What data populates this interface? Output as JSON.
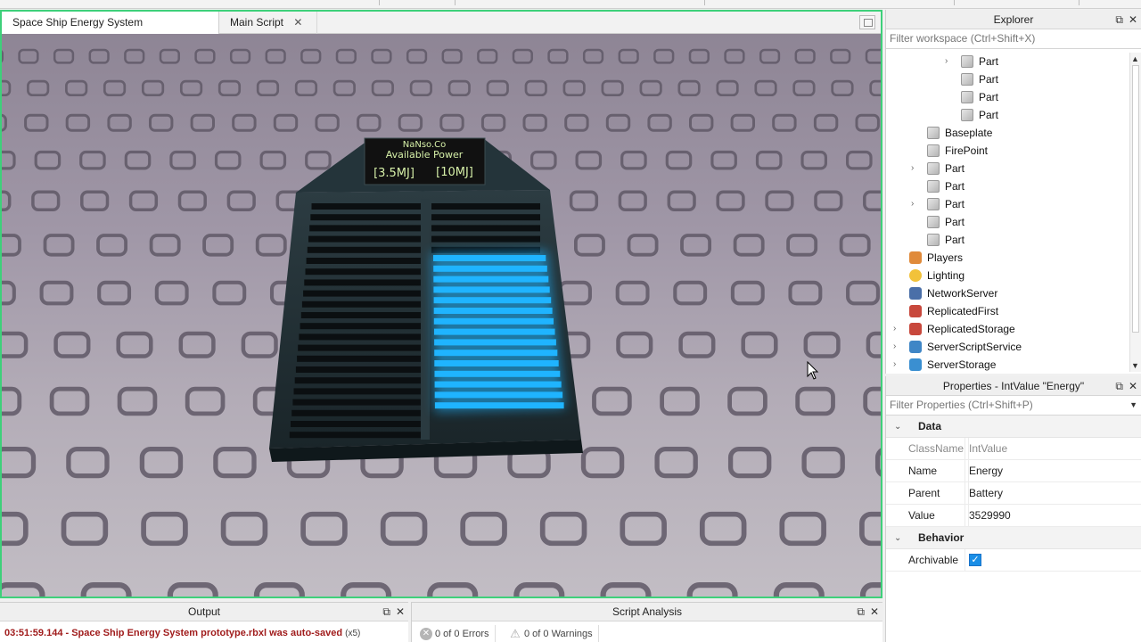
{
  "tabs": [
    {
      "label": "Space Ship Energy System prototype.rbxl",
      "close": "✕"
    },
    {
      "label": "Main Script",
      "close": "✕"
    }
  ],
  "battery_display": {
    "line1": "NaNso.Co",
    "line2": "Available Power",
    "current": "[3.5MJ]",
    "max": "[10MJ]"
  },
  "explorer": {
    "title": "Explorer",
    "filter_placeholder": "Filter workspace (Ctrl+Shift+X)",
    "items": [
      {
        "label": "Part",
        "icon": "part-icon",
        "expandable": true
      },
      {
        "label": "Part",
        "icon": "part-icon",
        "expandable": false
      },
      {
        "label": "Part",
        "icon": "part-icon",
        "expandable": false
      },
      {
        "label": "Part",
        "icon": "part-icon",
        "expandable": false
      },
      {
        "label": "Baseplate",
        "icon": "part-icon",
        "expandable": false
      },
      {
        "label": "FirePoint",
        "icon": "part-icon",
        "expandable": false
      },
      {
        "label": "Part",
        "icon": "part-icon",
        "expandable": true
      },
      {
        "label": "Part",
        "icon": "part-icon",
        "expandable": false
      },
      {
        "label": "Part",
        "icon": "part-icon",
        "expandable": true
      },
      {
        "label": "Part",
        "icon": "part-icon",
        "expandable": false
      },
      {
        "label": "Part",
        "icon": "part-icon",
        "expandable": false
      },
      {
        "label": "Players",
        "icon": "players-icon",
        "expandable": false
      },
      {
        "label": "Lighting",
        "icon": "lighting-icon",
        "expandable": false
      },
      {
        "label": "NetworkServer",
        "icon": "network-server-icon",
        "expandable": false
      },
      {
        "label": "ReplicatedFirst",
        "icon": "replicated-first-icon",
        "expandable": false
      },
      {
        "label": "ReplicatedStorage",
        "icon": "replicated-storage-icon",
        "expandable": true
      },
      {
        "label": "ServerScriptService",
        "icon": "server-script-service-icon",
        "expandable": true
      },
      {
        "label": "ServerStorage",
        "icon": "server-storage-icon",
        "expandable": true
      }
    ]
  },
  "properties": {
    "title": "Properties - IntValue \"Energy\"",
    "filter_placeholder": "Filter Properties (Ctrl+Shift+P)",
    "categories": [
      {
        "name": "Data",
        "rows": [
          {
            "name": "ClassName",
            "value": "IntValue"
          },
          {
            "name": "Name",
            "value": "Energy"
          },
          {
            "name": "Parent",
            "value": "Battery"
          },
          {
            "name": "Value",
            "value": "3529990"
          }
        ]
      },
      {
        "name": "Behavior",
        "rows": [
          {
            "name": "Archivable",
            "value": "✓"
          }
        ]
      }
    ]
  },
  "output": {
    "title": "Output",
    "message": "03:51:59.144 - Space Ship Energy System prototype.rbxl was auto-saved",
    "repeat": "(x5)"
  },
  "script_analysis": {
    "title": "Script Analysis",
    "errors": "0 of 0 Errors",
    "warnings": "0 of 0 Warnings"
  },
  "panel_controls": {
    "restore": "⧉",
    "close": "✕",
    "expand": "›",
    "collapse": "⌄",
    "scroll_up": "▲",
    "scroll_down": "▼",
    "dropdown": "▼"
  },
  "colors": {
    "selection_border": "#3ed07a",
    "energy_fill": "#1fb4ff",
    "output_text": "#a01c1c"
  }
}
